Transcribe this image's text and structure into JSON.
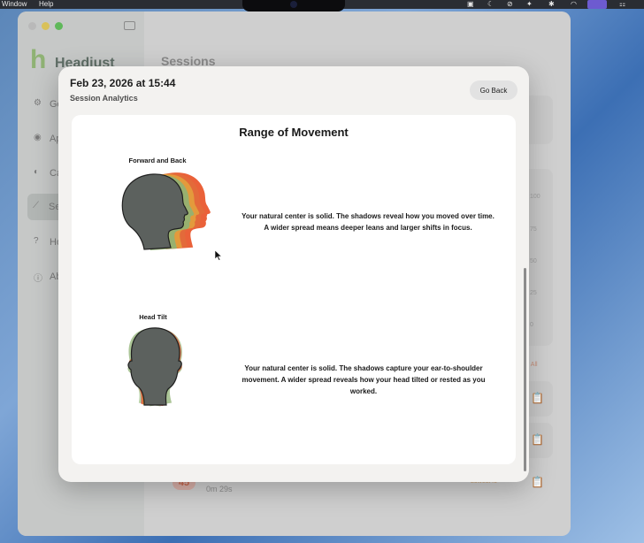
{
  "menubar": {
    "items": [
      "Window",
      "Help"
    ]
  },
  "background_app": {
    "app_name": "Headjust",
    "sidebar": {
      "items": [
        {
          "label": "Go",
          "icon": "gear-icon"
        },
        {
          "label": "Ap",
          "icon": "eye-icon"
        },
        {
          "label": "Ca",
          "icon": "speaker-icon"
        },
        {
          "label": "Se",
          "icon": "chart-icon",
          "active": true
        },
        {
          "label": "Ho",
          "icon": "question-icon"
        },
        {
          "label": "Ab",
          "icon": "info-icon"
        }
      ]
    },
    "main_title": "Sessions",
    "axis_ticks": [
      "100",
      "75",
      "50",
      "25",
      "0"
    ],
    "clear_all": "ar All",
    "last_row": {
      "score": "45",
      "time": "0m 29s",
      "tag": "Lowest fo"
    }
  },
  "modal": {
    "date": "Feb 23, 2026 at 15:44",
    "subtitle": "Session Analytics",
    "go_back_label": "Go Back",
    "section_title": "Range of Movement",
    "figures": [
      {
        "label": "Forward and Back",
        "description": "Your natural center is solid. The shadows reveal how you moved over time. A wider spread means deeper leans and larger shifts in focus."
      },
      {
        "label": "Head Tilt",
        "description": "Your natural center is solid. The shadows capture your ear-to-shoulder movement. A wider spread reveals how your head tilted or rested as you worked."
      }
    ]
  },
  "colors": {
    "head_solid": "#5c615e",
    "shadow_orange": "#e9592e",
    "shadow_amber": "#e39a3c",
    "shadow_green": "#8fb274",
    "shadow_red": "#d9433a"
  }
}
